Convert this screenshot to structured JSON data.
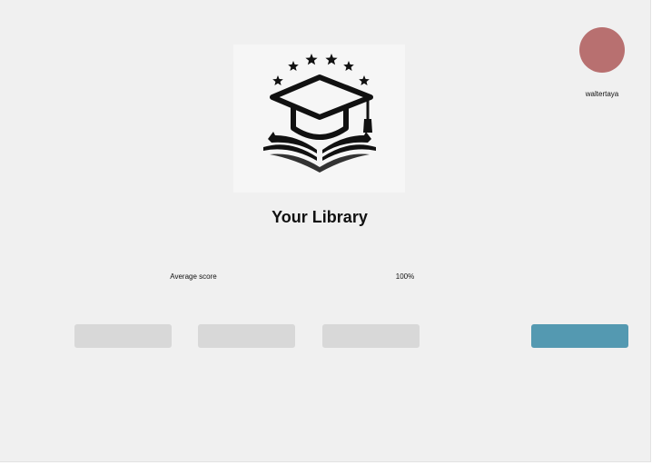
{
  "header": {
    "logo_icon": "graduation-cap-book-icon",
    "title": "Your Library"
  },
  "user": {
    "username": "waltertaya",
    "avatar_color": "#b87070"
  },
  "stats": {
    "label": "Average score",
    "value": "100%"
  },
  "buttons": {
    "items": [
      {
        "label": "",
        "color": "#d8d8d8"
      },
      {
        "label": "",
        "color": "#d8d8d8"
      },
      {
        "label": "",
        "color": "#d8d8d8"
      }
    ],
    "primary": {
      "label": "",
      "color": "#5499b1"
    }
  }
}
